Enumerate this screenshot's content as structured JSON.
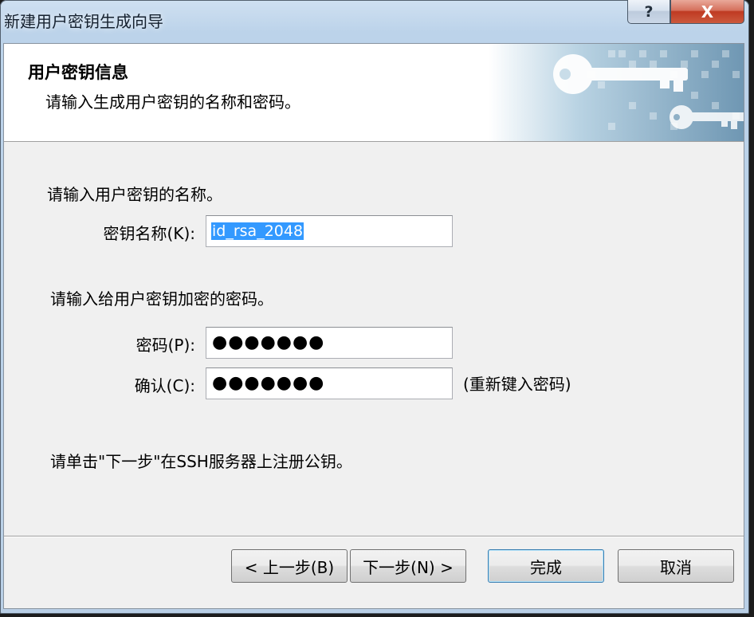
{
  "window": {
    "title": "新建用户密钥生成向导",
    "help_label": "?",
    "close_label": "X"
  },
  "header": {
    "title": "用户密钥信息",
    "subtitle": "请输入生成用户密钥的名称和密码。"
  },
  "name_section": {
    "prompt": "请输入用户密钥的名称。",
    "key_name_label": "密钥名称(K):",
    "key_name_value": "id_rsa_2048"
  },
  "password_section": {
    "prompt": "请输入给用户密钥加密的密码。",
    "password_label": "密码(P):",
    "password_mask": "●●●●●●●",
    "confirm_label": "确认(C):",
    "confirm_mask": "●●●●●●●",
    "confirm_hint": "(重新键入密码)"
  },
  "instruction": "请单击\"下一步\"在SSH服务器上注册公钥。",
  "buttons": {
    "back": "< 上一步(B)",
    "next": "下一步(N) >",
    "finish": "完成",
    "cancel": "取消"
  },
  "colors": {
    "selection": "#3399ff",
    "close_button": "#c8452a",
    "dialog_background": "#f0f0f0"
  },
  "icons": {
    "header_graphic": "keys-icon"
  }
}
